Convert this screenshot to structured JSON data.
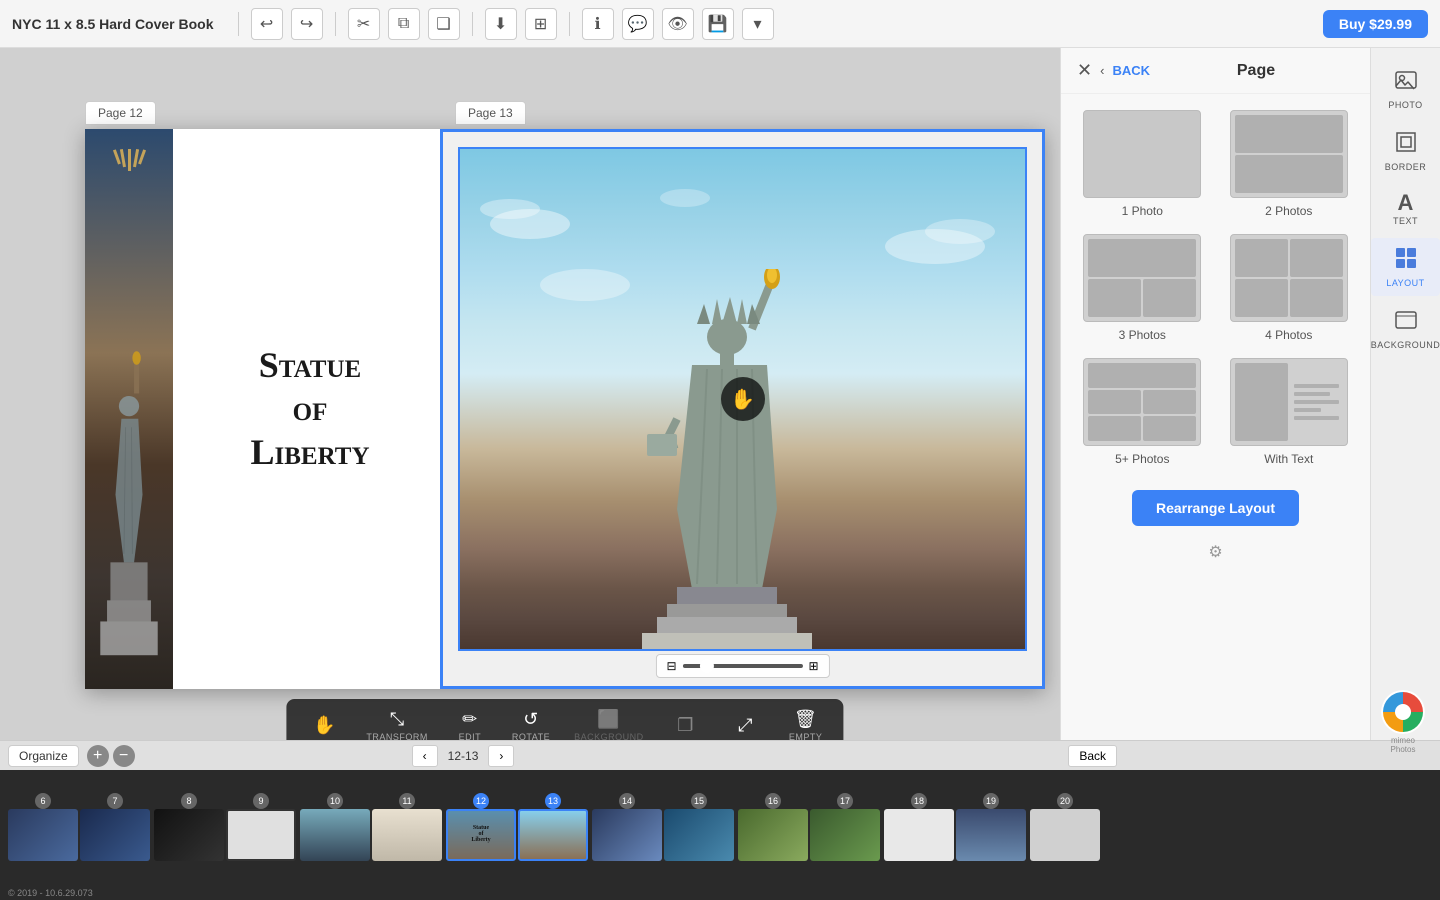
{
  "app": {
    "title": "NYC  11 x 8.5 Hard Cover Book"
  },
  "toolbar": {
    "undo_label": "↩",
    "redo_label": "↪",
    "cut_label": "✂",
    "copy_label": "⧉",
    "paste_label": "⬦",
    "download_label": "⬇",
    "expand_label": "⊞",
    "info_label": "ℹ",
    "comment_label": "💬",
    "preview_label": "👁",
    "save_label": "💾",
    "more_label": "▾",
    "buy_label": "Buy $29.99"
  },
  "pages": {
    "left_label": "Page 12",
    "right_label": "Page 13",
    "current": "12-13"
  },
  "left_page": {
    "title": "Statue\nof\nLiberty"
  },
  "right_panel": {
    "title": "Page",
    "back_label": "BACK",
    "layouts": [
      {
        "id": "1photo",
        "label": "1 Photo"
      },
      {
        "id": "2photos",
        "label": "2 Photos"
      },
      {
        "id": "3photos",
        "label": "3 Photos"
      },
      {
        "id": "4photos",
        "label": "4 Photos"
      },
      {
        "id": "5plus",
        "label": "5+ Photos"
      },
      {
        "id": "withtext",
        "label": "With Text"
      }
    ],
    "rearrange_label": "Rearrange Layout"
  },
  "icon_strip": {
    "items": [
      {
        "id": "photo",
        "label": "PHOTO",
        "icon": "🖼"
      },
      {
        "id": "border",
        "label": "BORDER",
        "icon": "⊞"
      },
      {
        "id": "text",
        "label": "TEXT",
        "icon": "A"
      },
      {
        "id": "layout",
        "label": "LAYOUT",
        "icon": "▦"
      },
      {
        "id": "background",
        "label": "BACKGROUND",
        "icon": "◫"
      }
    ]
  },
  "photo_toolbar": {
    "items": [
      {
        "id": "hand",
        "icon": "✋",
        "label": "",
        "disabled": false
      },
      {
        "id": "transform",
        "icon": "⤡",
        "label": "TRANSFORM",
        "disabled": false
      },
      {
        "id": "edit",
        "icon": "✏",
        "label": "EDIT",
        "disabled": false
      },
      {
        "id": "rotate",
        "icon": "↺",
        "label": "ROTATE",
        "disabled": false
      },
      {
        "id": "background",
        "icon": "⬜",
        "label": "BACKGROUND",
        "disabled": true
      },
      {
        "id": "duplicate",
        "icon": "⬡",
        "label": "",
        "disabled": true
      },
      {
        "id": "expand",
        "icon": "⤢",
        "label": "",
        "disabled": false
      },
      {
        "id": "delete",
        "icon": "🗑",
        "label": "EMPTY",
        "disabled": false
      }
    ]
  },
  "filmstrip": {
    "organize_label": "Organize",
    "add_label": "+",
    "remove_label": "-",
    "nav_label": "12-13",
    "back_label": "Back",
    "pages": [
      {
        "num": 6,
        "selected": false
      },
      {
        "num": 7,
        "selected": false
      },
      {
        "num": 8,
        "selected": false
      },
      {
        "num": 9,
        "selected": false
      },
      {
        "num": 10,
        "selected": false
      },
      {
        "num": 11,
        "selected": false
      },
      {
        "num": 12,
        "selected": true
      },
      {
        "num": 13,
        "selected": true
      },
      {
        "num": 14,
        "selected": false
      },
      {
        "num": 15,
        "selected": false
      },
      {
        "num": 16,
        "selected": false
      },
      {
        "num": 17,
        "selected": false
      },
      {
        "num": 18,
        "selected": false
      },
      {
        "num": 19,
        "selected": false
      },
      {
        "num": 20,
        "selected": false
      }
    ]
  },
  "copyright": "© 2019 - 10.6.29.073"
}
